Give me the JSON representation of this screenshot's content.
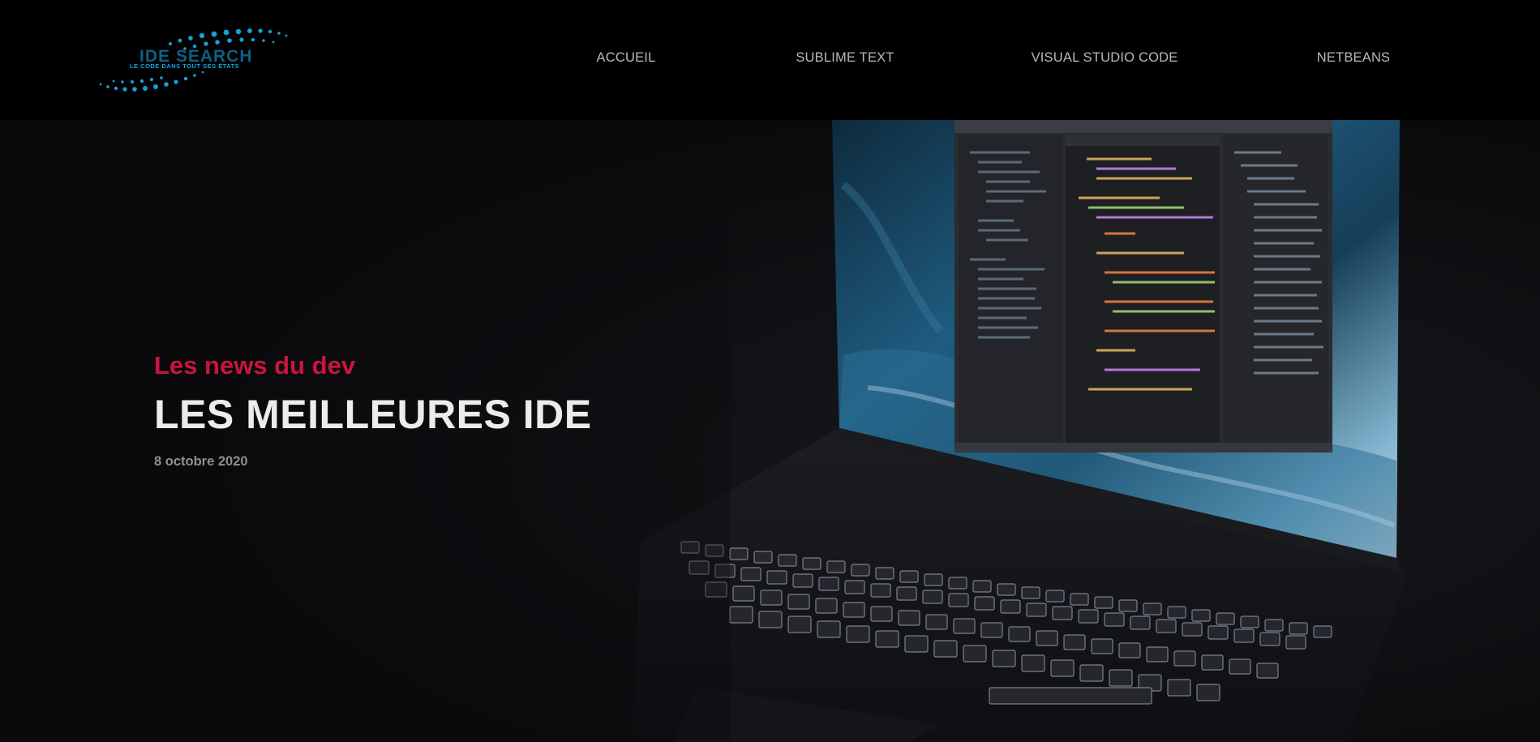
{
  "site": {
    "logo_title": "IDE SEARCH",
    "logo_tagline": "LE CODE DANS TOUT SES ÉTATS"
  },
  "nav": {
    "items": [
      {
        "label": "ACCUEIL"
      },
      {
        "label": "SUBLIME TEXT"
      },
      {
        "label": "VISUAL STUDIO CODE"
      },
      {
        "label": "NETBEANS"
      }
    ]
  },
  "hero": {
    "kicker": "Les news du dev",
    "title": "LES MEILLEURES IDE",
    "date": "8 octobre 2020",
    "image_subject": "laptop-with-ide-screen"
  },
  "colors": {
    "kicker": "#c8153f",
    "title": "#ececec",
    "nav_text": "#b9b9b9",
    "logo_accent": "#1ba3d8",
    "header_bg": "#000000",
    "hero_bg": "#0b0b0d"
  }
}
